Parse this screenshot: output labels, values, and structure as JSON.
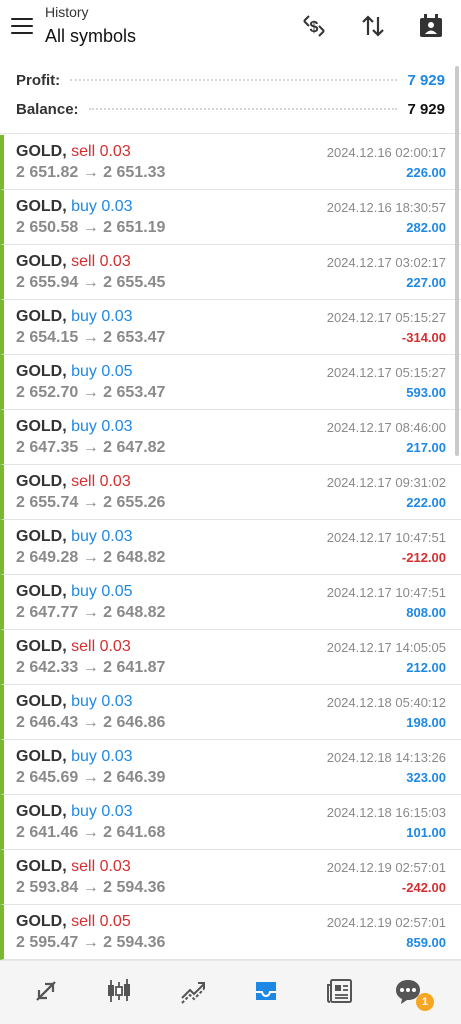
{
  "header": {
    "subtitle": "History",
    "title": "All symbols",
    "icons": [
      "menu-icon",
      "dollar-swap-icon",
      "sort-icon",
      "calendar-icon"
    ]
  },
  "summary": {
    "profit_label": "Profit:",
    "profit_value": "7 929",
    "balance_label": "Balance:",
    "balance_value": "7 929"
  },
  "colors": {
    "buy": "#1e88e5",
    "sell": "#d32f2f",
    "row_marker": "#7cb82f",
    "active_tab": "#1e88e5",
    "badge": "#f5a623"
  },
  "deals": [
    {
      "symbol": "GOLD,",
      "type": "sell 0.03",
      "prices": "2 651.82 → 2 651.33",
      "time": "2024.12.16 02:00:17",
      "profit": "226.00"
    },
    {
      "symbol": "GOLD,",
      "type": "buy 0.03",
      "prices": "2 650.58 → 2 651.19",
      "time": "2024.12.16 18:30:57",
      "profit": "282.00"
    },
    {
      "symbol": "GOLD,",
      "type": "sell 0.03",
      "prices": "2 655.94 → 2 655.45",
      "time": "2024.12.17 03:02:17",
      "profit": "227.00"
    },
    {
      "symbol": "GOLD,",
      "type": "buy 0.03",
      "prices": "2 654.15 → 2 653.47",
      "time": "2024.12.17 05:15:27",
      "profit": "-314.00"
    },
    {
      "symbol": "GOLD,",
      "type": "buy 0.05",
      "prices": "2 652.70 → 2 653.47",
      "time": "2024.12.17 05:15:27",
      "profit": "593.00"
    },
    {
      "symbol": "GOLD,",
      "type": "buy 0.03",
      "prices": "2 647.35 → 2 647.82",
      "time": "2024.12.17 08:46:00",
      "profit": "217.00"
    },
    {
      "symbol": "GOLD,",
      "type": "sell 0.03",
      "prices": "2 655.74 → 2 655.26",
      "time": "2024.12.17 09:31:02",
      "profit": "222.00"
    },
    {
      "symbol": "GOLD,",
      "type": "buy 0.03",
      "prices": "2 649.28 → 2 648.82",
      "time": "2024.12.17 10:47:51",
      "profit": "-212.00"
    },
    {
      "symbol": "GOLD,",
      "type": "buy 0.05",
      "prices": "2 647.77 → 2 648.82",
      "time": "2024.12.17 10:47:51",
      "profit": "808.00"
    },
    {
      "symbol": "GOLD,",
      "type": "sell 0.03",
      "prices": "2 642.33 → 2 641.87",
      "time": "2024.12.17 14:05:05",
      "profit": "212.00"
    },
    {
      "symbol": "GOLD,",
      "type": "buy 0.03",
      "prices": "2 646.43 → 2 646.86",
      "time": "2024.12.18 05:40:12",
      "profit": "198.00"
    },
    {
      "symbol": "GOLD,",
      "type": "buy 0.03",
      "prices": "2 645.69 → 2 646.39",
      "time": "2024.12.18 14:13:26",
      "profit": "323.00"
    },
    {
      "symbol": "GOLD,",
      "type": "buy 0.03",
      "prices": "2 641.46 → 2 641.68",
      "time": "2024.12.18 16:15:03",
      "profit": "101.00"
    },
    {
      "symbol": "GOLD,",
      "type": "sell 0.03",
      "prices": "2 593.84 → 2 594.36",
      "time": "2024.12.19 02:57:01",
      "profit": "-242.00"
    },
    {
      "symbol": "GOLD,",
      "type": "sell 0.05",
      "prices": "2 595.47 → 2 594.36",
      "time": "2024.12.19 02:57:01",
      "profit": "859.00"
    }
  ],
  "bottom_nav": {
    "items": [
      "quotes-icon",
      "chart-icon",
      "trade-icon",
      "history-icon",
      "news-icon",
      "chat-icon"
    ],
    "active": "history-icon",
    "chat_badge": "1"
  }
}
